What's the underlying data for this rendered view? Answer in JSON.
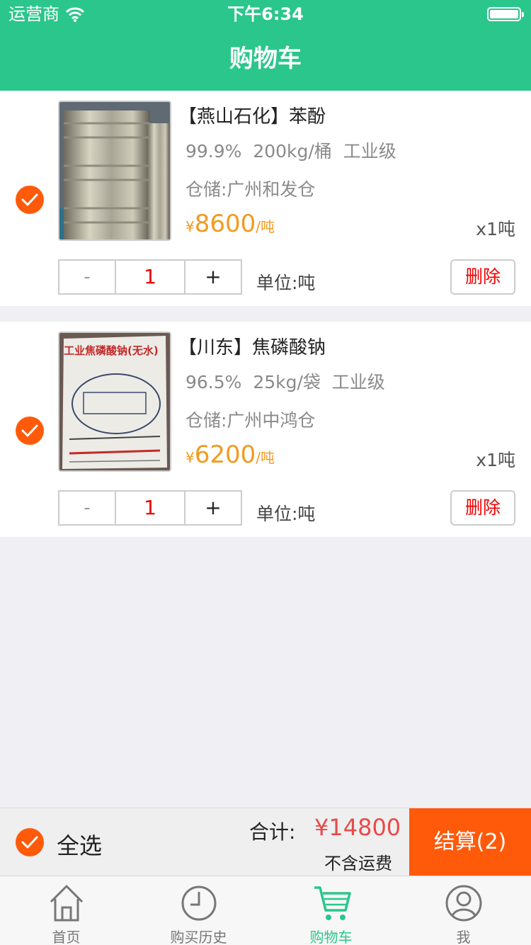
{
  "status_bar": {
    "carrier": "运营商",
    "time": "下午6:34"
  },
  "header": {
    "title": "购物车"
  },
  "cart_items": [
    {
      "name": "【燕山石化】苯酚",
      "specs": "99.9%  200kg/桶  工业级",
      "warehouse": "仓储:广州和发仓",
      "currency": "¥",
      "price": "8600",
      "price_unit": "/吨",
      "qty_text": "x1吨",
      "stepper_minus": "-",
      "stepper_value": "1",
      "stepper_plus": "+",
      "unit_label": "单位:吨",
      "delete_label": "删除",
      "image_text": ""
    },
    {
      "name": "【川东】焦磷酸钠",
      "specs": "96.5%  25kg/袋  工业级",
      "warehouse": "仓储:广州中鸿仓",
      "currency": "¥",
      "price": "6200",
      "price_unit": "/吨",
      "qty_text": "x1吨",
      "stepper_minus": "-",
      "stepper_value": "1",
      "stepper_plus": "+",
      "unit_label": "单位:吨",
      "delete_label": "删除",
      "image_text": "工业焦磷酸钠(无水)"
    }
  ],
  "checkout": {
    "select_all_label": "全选",
    "total_label": "合计:",
    "total_value": "¥14800",
    "shipping_note": "不含运费",
    "checkout_label": "结算(2)"
  },
  "tabbar": {
    "tabs": [
      {
        "label": "首页",
        "icon": "home-icon"
      },
      {
        "label": "购买历史",
        "icon": "clock-icon"
      },
      {
        "label": "购物车",
        "icon": "cart-icon",
        "active": true
      },
      {
        "label": "我",
        "icon": "user-icon"
      }
    ]
  },
  "colors": {
    "header_green": "#2bc68b",
    "accent_orange": "#ff5a0a",
    "price_orange": "#f39a1f",
    "delete_red": "#e00000",
    "total_red": "#e84a4a"
  }
}
